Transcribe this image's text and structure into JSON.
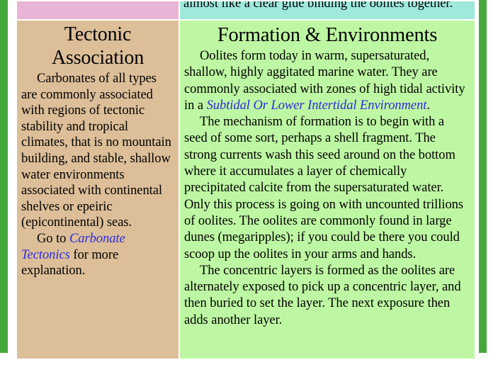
{
  "page": {
    "background_color": "#FFFFFF",
    "edge_bar_color": "#45A83A",
    "link_color": "#2A2AE0"
  },
  "clipped_row": {
    "left_cell": {
      "background_color": "#E9B4D6",
      "text": ""
    },
    "right_cell": {
      "background_color": "#9EE8DC",
      "text": "almost like a clear glue binding the oolites together."
    }
  },
  "columns": [
    {
      "id": "tectonic-association",
      "background_color": "#DCBE98",
      "heading": "Tectonic Association",
      "paragraphs": [
        {
          "parts": [
            {
              "type": "text",
              "text": "Carbonates of all types are commonly associated with regions of tectonic stability and tropical climates, that is no mountain building, and stable, shallow water environments associated with continental shelves or epeiric (epicontinental) seas."
            }
          ]
        },
        {
          "parts": [
            {
              "type": "text",
              "text": "Go to "
            },
            {
              "type": "link",
              "text": "Carbonate Tectonics"
            },
            {
              "type": "text",
              "text": " for more explanation."
            }
          ]
        }
      ]
    },
    {
      "id": "formation-environments",
      "background_color": "#BEF7A3",
      "heading": "Formation & Environments",
      "paragraphs": [
        {
          "parts": [
            {
              "type": "text",
              "text": "Oolites form today in warm, supersaturated, shallow, highly aggitated marine water. They are commonly associated with zones of high tidal activity in a "
            },
            {
              "type": "link",
              "text": "Subtidal Or Lower Intertidal Environment"
            },
            {
              "type": "text",
              "text": "."
            }
          ]
        },
        {
          "parts": [
            {
              "type": "text",
              "text": "The mechanism of formation is to begin with a seed of some sort, perhaps a shell fragment. The strong currents wash this seed around on the bottom where it accumulates a layer of chemically precipitated calcite from the supersaturated water. Only this process is going on with uncounted trillions of oolites. The oolites are commonly found in large dunes (megaripples); if you could be there you could scoop up the oolites in your arms and hands."
            }
          ]
        },
        {
          "parts": [
            {
              "type": "text",
              "text": "The concentric layers is formed as the oolites are alternately exposed to pick up a concentric layer, and then buried to set the layer. The next exposure then adds another layer."
            }
          ]
        }
      ]
    }
  ]
}
